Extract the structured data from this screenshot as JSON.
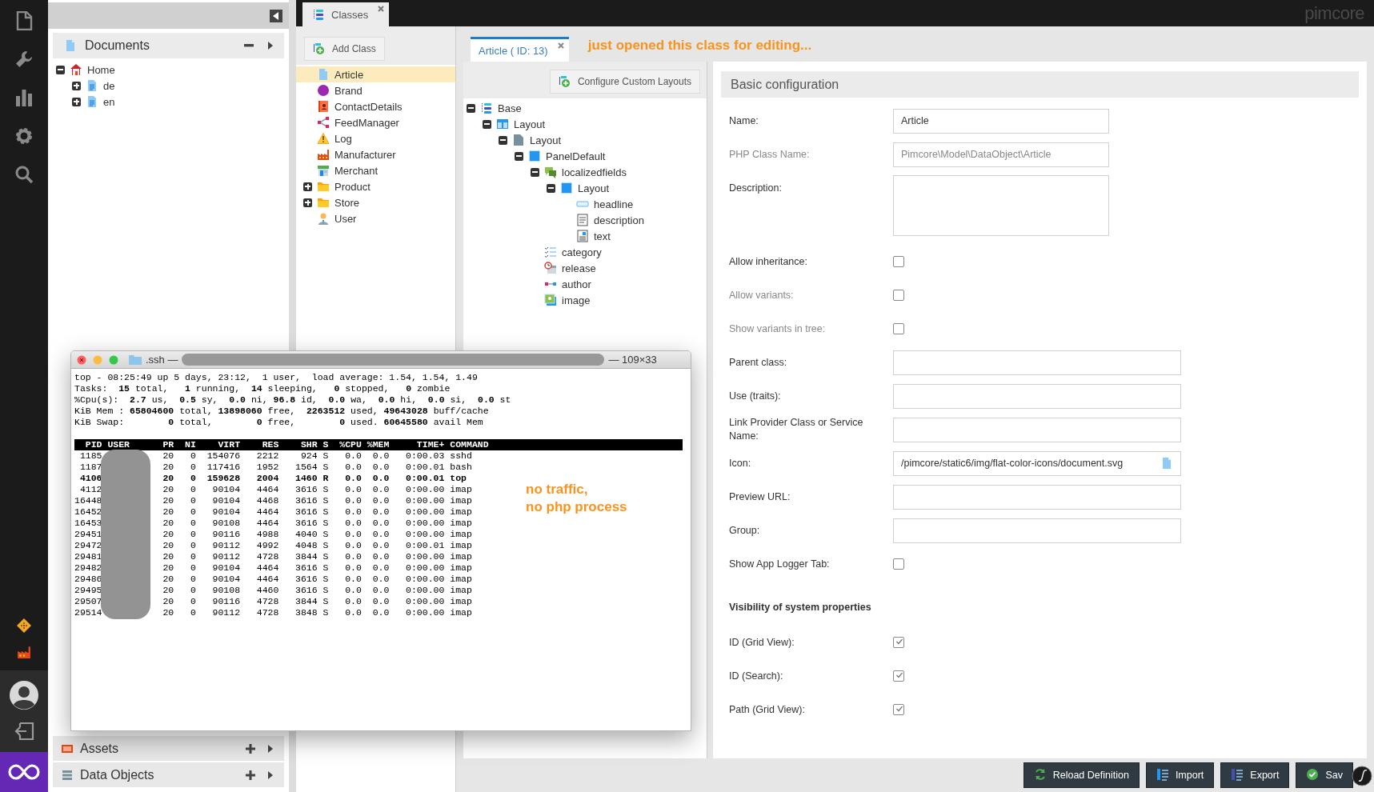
{
  "top_bar": {
    "logo": "pimcore"
  },
  "documents_panel": {
    "title": "Documents",
    "tree": [
      {
        "label": "Home",
        "kind": "home",
        "expanded": true,
        "children": [
          {
            "label": "de",
            "kind": "page",
            "expanded": false
          },
          {
            "label": "en",
            "kind": "page",
            "expanded": false
          }
        ]
      }
    ]
  },
  "bottom_panels": [
    {
      "title": "Assets",
      "kind": "assets"
    },
    {
      "title": "Data Objects",
      "kind": "objects"
    }
  ],
  "tabs": [
    {
      "label": "Classes",
      "selected": true
    }
  ],
  "classes_panel": {
    "add_button": "Add Class",
    "items": [
      {
        "label": "Article",
        "kind": "document",
        "selected": true
      },
      {
        "label": "Brand",
        "kind": "tm",
        "selected": false
      },
      {
        "label": "ContactDetails",
        "kind": "contact",
        "selected": false
      },
      {
        "label": "FeedManager",
        "kind": "feed",
        "selected": false
      },
      {
        "label": "Log",
        "kind": "warning",
        "selected": false
      },
      {
        "label": "Manufacturer",
        "kind": "factory",
        "selected": false
      },
      {
        "label": "Merchant",
        "kind": "shop",
        "selected": false
      },
      {
        "label": "Product",
        "kind": "folder",
        "selected": false,
        "expanded": false
      },
      {
        "label": "Store",
        "kind": "folder",
        "selected": false,
        "expanded": false
      },
      {
        "label": "User",
        "kind": "user",
        "selected": false
      }
    ]
  },
  "editor": {
    "tabs": [
      {
        "label": "Article ( ID: 13)",
        "selected": true
      }
    ],
    "annotation": "just opened this class for editing...",
    "layouts_button": "Configure Custom Layouts",
    "tree": [
      {
        "label": "Base",
        "kind": "classdef",
        "expanded": true,
        "children": [
          {
            "label": "Layout",
            "kind": "layout",
            "expanded": true,
            "children": [
              {
                "label": "Layout",
                "kind": "tab",
                "expanded": true,
                "children": [
                  {
                    "label": "PanelDefault",
                    "kind": "panel",
                    "expanded": true,
                    "children": [
                      {
                        "label": "localizedfields",
                        "kind": "localized",
                        "expanded": true,
                        "children": [
                          {
                            "label": "Layout",
                            "kind": "panel",
                            "expanded": true,
                            "children": [
                              {
                                "label": "headline",
                                "kind": "input"
                              },
                              {
                                "label": "description",
                                "kind": "textarea"
                              },
                              {
                                "label": "text",
                                "kind": "wysiwyg"
                              }
                            ]
                          }
                        ]
                      },
                      {
                        "label": "category",
                        "kind": "checklist"
                      },
                      {
                        "label": "release",
                        "kind": "date"
                      },
                      {
                        "label": "author",
                        "kind": "relation"
                      },
                      {
                        "label": "image",
                        "kind": "image"
                      }
                    ]
                  }
                ]
              }
            ]
          }
        ]
      }
    ]
  },
  "config": {
    "title": "Basic configuration",
    "fields": [
      {
        "kind": "input",
        "label": "Name:",
        "value": "Article",
        "disabled": false
      },
      {
        "kind": "input",
        "label": "PHP Class Name:",
        "value": "Pimcore\\Model\\DataObject\\Article",
        "disabled": true
      },
      {
        "kind": "textarea",
        "label": "Description:",
        "disabled": false
      },
      {
        "kind": "checkbox",
        "label": "Allow inheritance:",
        "checked": false,
        "disabled": false
      },
      {
        "kind": "checkbox",
        "label": "Allow variants:",
        "checked": false,
        "disabled": true
      },
      {
        "kind": "checkbox",
        "label": "Show variants in tree:",
        "checked": false,
        "disabled": true
      },
      {
        "kind": "wide-input",
        "label": "Parent class:",
        "disabled": false
      },
      {
        "kind": "wide-input",
        "label": "Use (traits):",
        "disabled": false
      },
      {
        "kind": "wide-input",
        "label": "Link Provider Class or Service Name:",
        "disabled": false
      },
      {
        "kind": "icon-input",
        "label": "Icon:",
        "value": "/pimcore/static6/img/flat-color-icons/document.svg",
        "disabled": false
      },
      {
        "kind": "wide-input",
        "label": "Preview URL:",
        "disabled": false
      },
      {
        "kind": "wide-input",
        "label": "Group:",
        "disabled": false
      },
      {
        "kind": "checkbox",
        "label": "Show App Logger Tab:",
        "checked": false,
        "disabled": false
      },
      {
        "kind": "heading",
        "label": "Visibility of system properties"
      },
      {
        "kind": "checkbox",
        "label": "ID (Grid View):",
        "checked": true,
        "disabled": false
      },
      {
        "kind": "checkbox",
        "label": "ID (Search):",
        "checked": true,
        "disabled": false
      },
      {
        "kind": "checkbox",
        "label": "Path (Grid View):",
        "checked": true,
        "disabled": false
      }
    ]
  },
  "buttons": [
    {
      "label": "Reload Definition",
      "kind": "reload"
    },
    {
      "label": "Import",
      "kind": "import"
    },
    {
      "label": "Export",
      "kind": "export"
    },
    {
      "label": "Sav",
      "kind": "save"
    }
  ],
  "terminal": {
    "title": ".ssh —",
    "size": "— 109×33",
    "summary": [
      "top - 08:25:49 up 5 days, 23:12,  1 user,  load average: 1.54, 1.54, 1.49",
      "Tasks:  **15** total,   **1** running,  **14** sleeping,   **0** stopped,   **0** zombie",
      "%Cpu(s):  **2.7** us,  **0.5** sy,  **0.0** ni, **96.8** id,  **0.0** wa,  **0.0** hi,  **0.0** si,  **0.0** st",
      "KiB Mem : **65804600** total, **13898060** free,  **2263512** used, **49643028** buff/cache",
      "KiB Swap:        **0** total,        **0** free,        **0** used. **60645580** avail Mem"
    ],
    "header": "  PID USER      PR  NI    VIRT    RES    SHR S  %CPU %MEM     TIME+ COMMAND",
    "rows": [
      {
        "pid": "1185",
        "pr": "20",
        "ni": "0",
        "virt": "154076",
        "res": "2212",
        "shr": "924",
        "s": "S",
        "cpu": "0.0",
        "mem": "0.0",
        "time": "0:00.03",
        "command": "sshd",
        "bold": false
      },
      {
        "pid": "1187",
        "pr": "20",
        "ni": "0",
        "virt": "117416",
        "res": "1952",
        "shr": "1564",
        "s": "S",
        "cpu": "0.0",
        "mem": "0.0",
        "time": "0:00.01",
        "command": "bash",
        "bold": false
      },
      {
        "pid": "4106",
        "pr": "20",
        "ni": "0",
        "virt": "159628",
        "res": "2004",
        "shr": "1460",
        "s": "R",
        "cpu": "0.0",
        "mem": "0.0",
        "time": "0:00.01",
        "command": "top",
        "bold": true
      },
      {
        "pid": "4112",
        "pr": "20",
        "ni": "0",
        "virt": "90104",
        "res": "4464",
        "shr": "3616",
        "s": "S",
        "cpu": "0.0",
        "mem": "0.0",
        "time": "0:00.00",
        "command": "imap",
        "bold": false
      },
      {
        "pid": "16448",
        "pr": "20",
        "ni": "0",
        "virt": "90104",
        "res": "4468",
        "shr": "3616",
        "s": "S",
        "cpu": "0.0",
        "mem": "0.0",
        "time": "0:00.00",
        "command": "imap",
        "bold": false
      },
      {
        "pid": "16452",
        "pr": "20",
        "ni": "0",
        "virt": "90104",
        "res": "4464",
        "shr": "3616",
        "s": "S",
        "cpu": "0.0",
        "mem": "0.0",
        "time": "0:00.00",
        "command": "imap",
        "bold": false
      },
      {
        "pid": "16453",
        "pr": "20",
        "ni": "0",
        "virt": "90108",
        "res": "4464",
        "shr": "3616",
        "s": "S",
        "cpu": "0.0",
        "mem": "0.0",
        "time": "0:00.00",
        "command": "imap",
        "bold": false
      },
      {
        "pid": "29451",
        "pr": "20",
        "ni": "0",
        "virt": "90116",
        "res": "4988",
        "shr": "4040",
        "s": "S",
        "cpu": "0.0",
        "mem": "0.0",
        "time": "0:00.00",
        "command": "imap",
        "bold": false
      },
      {
        "pid": "29472",
        "pr": "20",
        "ni": "0",
        "virt": "90112",
        "res": "4992",
        "shr": "4048",
        "s": "S",
        "cpu": "0.0",
        "mem": "0.0",
        "time": "0:00.01",
        "command": "imap",
        "bold": false
      },
      {
        "pid": "29481",
        "pr": "20",
        "ni": "0",
        "virt": "90112",
        "res": "4728",
        "shr": "3844",
        "s": "S",
        "cpu": "0.0",
        "mem": "0.0",
        "time": "0:00.00",
        "command": "imap",
        "bold": false
      },
      {
        "pid": "29482",
        "pr": "20",
        "ni": "0",
        "virt": "90104",
        "res": "4464",
        "shr": "3616",
        "s": "S",
        "cpu": "0.0",
        "mem": "0.0",
        "time": "0:00.00",
        "command": "imap",
        "bold": false
      },
      {
        "pid": "29486",
        "pr": "20",
        "ni": "0",
        "virt": "90104",
        "res": "4464",
        "shr": "3616",
        "s": "S",
        "cpu": "0.0",
        "mem": "0.0",
        "time": "0:00.00",
        "command": "imap",
        "bold": false
      },
      {
        "pid": "29495",
        "pr": "20",
        "ni": "0",
        "virt": "90108",
        "res": "4460",
        "shr": "3616",
        "s": "S",
        "cpu": "0.0",
        "mem": "0.0",
        "time": "0:00.00",
        "command": "imap",
        "bold": false
      },
      {
        "pid": "29507",
        "pr": "20",
        "ni": "0",
        "virt": "90116",
        "res": "4728",
        "shr": "3844",
        "s": "S",
        "cpu": "0.0",
        "mem": "0.0",
        "time": "0:00.00",
        "command": "imap",
        "bold": false
      },
      {
        "pid": "29514",
        "pr": "20",
        "ni": "0",
        "virt": "90112",
        "res": "4728",
        "shr": "3848",
        "s": "S",
        "cpu": "0.0",
        "mem": "0.0",
        "time": "0:00.00",
        "command": "imap",
        "bold": false
      }
    ],
    "annotation": "no traffic,\nno php process"
  }
}
